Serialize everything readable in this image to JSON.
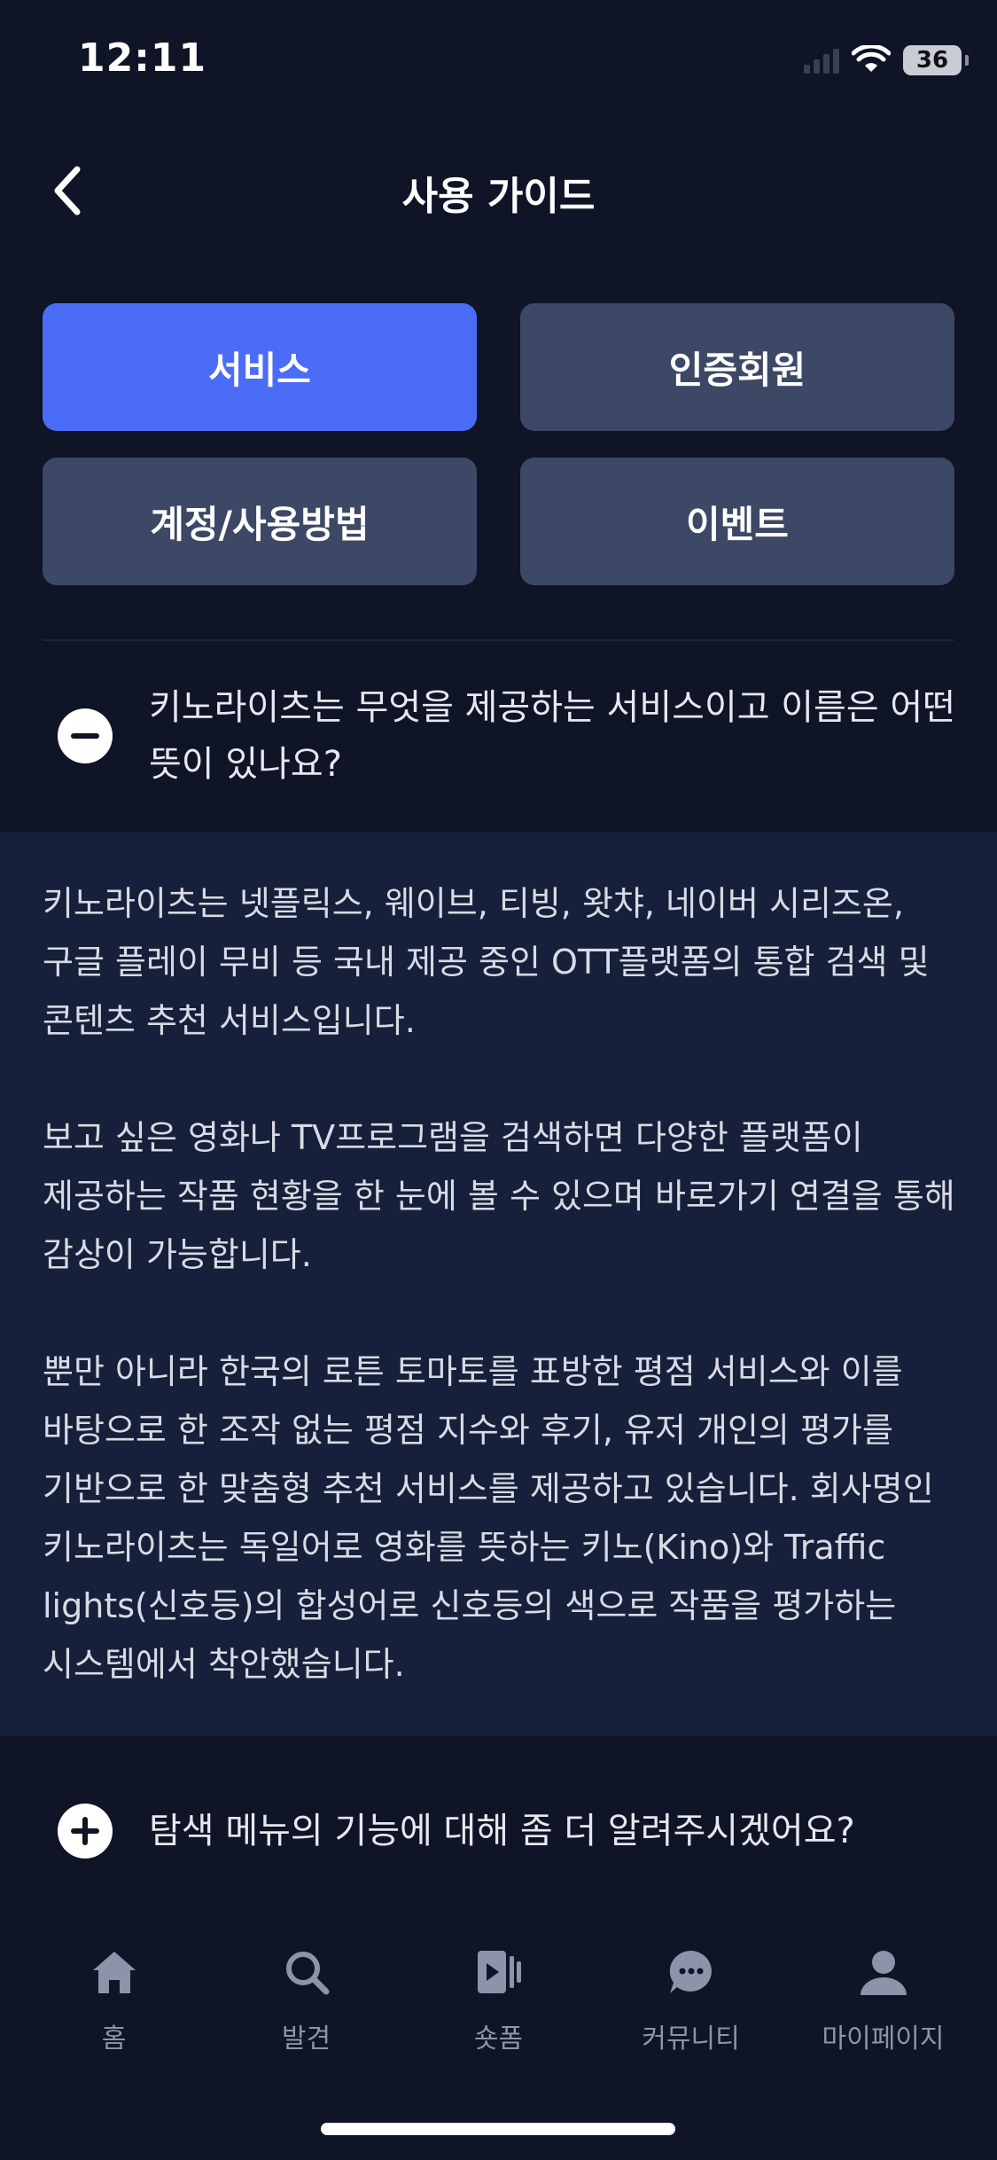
{
  "status": {
    "time": "12:11",
    "battery": "36"
  },
  "header": {
    "title": "사용 가이드"
  },
  "tabs": [
    {
      "label": "서비스",
      "active": true
    },
    {
      "label": "인증회원",
      "active": false
    },
    {
      "label": "계정/사용방법",
      "active": false
    },
    {
      "label": "이벤트",
      "active": false
    }
  ],
  "faq": [
    {
      "question": "키노라이츠는 무엇을 제공하는 서비스이고 이름은 어떤 뜻이 있나요?",
      "expanded": true,
      "answer": [
        "키노라이츠는 넷플릭스, 웨이브, 티빙, 왓챠, 네이버 시리즈온, 구글 플레이 무비 등 국내 제공 중인 OTT플랫폼의 통합 검색 및 콘텐츠 추천 서비스입니다.",
        "보고 싶은 영화나 TV프로그램을 검색하면 다양한 플랫폼이 제공하는 작품 현황을 한 눈에 볼 수 있으며 바로가기 연결을 통해 감상이 가능합니다.",
        "뿐만 아니라 한국의 로튼 토마토를 표방한 평점 서비스와 이를 바탕으로 한 조작 없는 평점 지수와 후기, 유저 개인의 평가를 기반으로 한 맞춤형 추천 서비스를 제공하고 있습니다. 회사명인 키노라이츠는 독일어로 영화를 뜻하는 키노(Kino)와 Traffic lights(신호등)의 합성어로 신호등의 색으로 작품을 평가하는 시스템에서 착안했습니다."
      ]
    },
    {
      "question": "탐색 메뉴의 기능에 대해 좀 더 알려주시겠어요?",
      "expanded": false
    }
  ],
  "bottom_nav": [
    {
      "label": "홈",
      "icon": "home-icon"
    },
    {
      "label": "발견",
      "icon": "search-icon"
    },
    {
      "label": "숏폼",
      "icon": "shortform-icon"
    },
    {
      "label": "커뮤니티",
      "icon": "chat-icon"
    },
    {
      "label": "마이페이지",
      "icon": "person-icon"
    }
  ],
  "colors": {
    "background": "#0f1426",
    "answer_background": "#17203a",
    "tab_active": "#4a6cf7",
    "tab_inactive": "#3d4866"
  }
}
